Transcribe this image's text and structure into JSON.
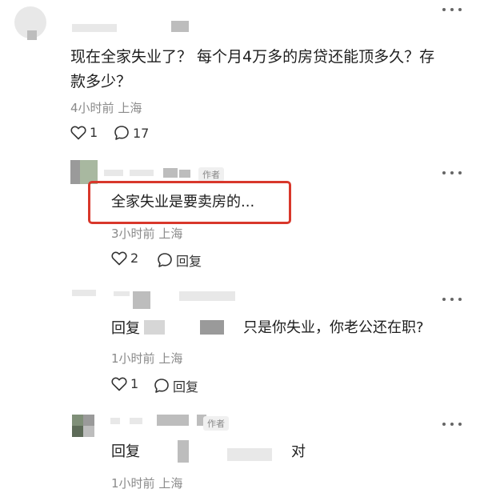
{
  "top_comment": {
    "text": "现在全家失业了？ 每个月4万多的房贷还能顶多久？存款多少？",
    "line1": "现在全家失业了？ 每个月4万多的房贷还能顶多久？存",
    "line2": "款多少？",
    "time": "4小时前",
    "location": "上海",
    "like_count": "1",
    "comment_count": "17",
    "more_icon": "more-dots-icon"
  },
  "reply_1": {
    "author_tag": "作者",
    "text": "全家失业是要卖房的...",
    "time": "3小时前",
    "location": "上海",
    "like_count": "2",
    "reply_label": "回复",
    "highlight_color": "#d8372b"
  },
  "reply_2": {
    "prefix": "回复",
    "text": "只是你失业，你老公还在职?",
    "time": "1小时前",
    "location": "上海",
    "like_count": "1",
    "reply_label": "回复"
  },
  "reply_3": {
    "author_tag": "作者",
    "prefix": "回复",
    "text": "对",
    "time": "1小时前",
    "location": "上海"
  },
  "colors": {
    "accent_red": "#d8372b",
    "meta_gray": "#8a8a8a",
    "text": "#1e1e1e"
  }
}
